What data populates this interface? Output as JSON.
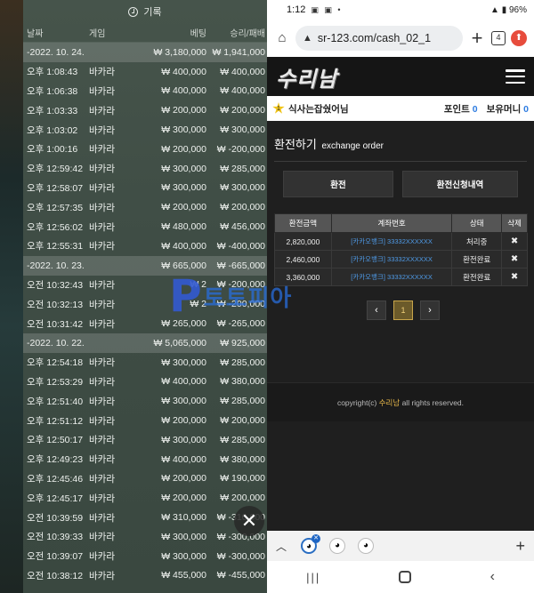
{
  "log": {
    "title": "기록",
    "columns": [
      "날짜",
      "게임",
      "베팅",
      "승리/패배"
    ],
    "rows": [
      {
        "type": "date",
        "date": "-2022. 10. 24.",
        "bet": "₩ 3,180,000",
        "result": "₩ 1,941,000"
      },
      {
        "time": "오후 1:08:43",
        "game": "바카라",
        "bet": "₩ 400,000",
        "result": "₩ 400,000"
      },
      {
        "time": "오후 1:06:38",
        "game": "바카라",
        "bet": "₩ 400,000",
        "result": "₩ 400,000"
      },
      {
        "time": "오후 1:03:33",
        "game": "바카라",
        "bet": "₩ 200,000",
        "result": "₩ 200,000"
      },
      {
        "time": "오후 1:03:02",
        "game": "바카라",
        "bet": "₩ 300,000",
        "result": "₩ 300,000"
      },
      {
        "time": "오후 1:00:16",
        "game": "바카라",
        "bet": "₩ 200,000",
        "result": "₩ -200,000"
      },
      {
        "time": "오후 12:59:42",
        "game": "바카라",
        "bet": "₩ 300,000",
        "result": "₩ 285,000"
      },
      {
        "time": "오후 12:58:07",
        "game": "바카라",
        "bet": "₩ 300,000",
        "result": "₩ 300,000"
      },
      {
        "time": "오후 12:57:35",
        "game": "바카라",
        "bet": "₩ 200,000",
        "result": "₩ 200,000"
      },
      {
        "time": "오후 12:56:02",
        "game": "바카라",
        "bet": "₩ 480,000",
        "result": "₩ 456,000"
      },
      {
        "time": "오후 12:55:31",
        "game": "바카라",
        "bet": "₩ 400,000",
        "result": "₩ -400,000"
      },
      {
        "type": "date",
        "date": "-2022. 10. 23.",
        "bet": "₩ 665,000",
        "result": "₩ -665,000"
      },
      {
        "time": "오전 10:32:43",
        "game": "바카라",
        "bet": "₩ 2",
        "result": "₩ -200,000"
      },
      {
        "time": "오전 10:32:13",
        "game": "바카라",
        "bet": "₩ 2",
        "result": "₩ -200,000"
      },
      {
        "time": "오전 10:31:42",
        "game": "바카라",
        "bet": "₩ 265,000",
        "result": "₩ -265,000"
      },
      {
        "type": "date",
        "date": "-2022. 10. 22.",
        "bet": "₩ 5,065,000",
        "result": "₩ 925,000"
      },
      {
        "time": "오후 12:54:18",
        "game": "바카라",
        "bet": "₩ 300,000",
        "result": "₩ 285,000"
      },
      {
        "time": "오후 12:53:29",
        "game": "바카라",
        "bet": "₩ 400,000",
        "result": "₩ 380,000"
      },
      {
        "time": "오후 12:51:40",
        "game": "바카라",
        "bet": "₩ 300,000",
        "result": "₩ 285,000"
      },
      {
        "time": "오후 12:51:12",
        "game": "바카라",
        "bet": "₩ 200,000",
        "result": "₩ 200,000"
      },
      {
        "time": "오후 12:50:17",
        "game": "바카라",
        "bet": "₩ 300,000",
        "result": "₩ 285,000"
      },
      {
        "time": "오후 12:49:23",
        "game": "바카라",
        "bet": "₩ 400,000",
        "result": "₩ 380,000"
      },
      {
        "time": "오후 12:45:46",
        "game": "바카라",
        "bet": "₩ 200,000",
        "result": "₩ 190,000"
      },
      {
        "time": "오후 12:45:17",
        "game": "바카라",
        "bet": "₩ 200,000",
        "result": "₩ 200,000"
      },
      {
        "time": "오전 10:39:59",
        "game": "바카라",
        "bet": "₩ 310,000",
        "result": "₩ -310,000"
      },
      {
        "time": "오전 10:39:33",
        "game": "바카라",
        "bet": "₩ 300,000",
        "result": "₩ -300,000"
      },
      {
        "time": "오전 10:39:07",
        "game": "바카라",
        "bet": "₩ 300,000",
        "result": "₩ -300,000"
      },
      {
        "time": "오전 10:38:12",
        "game": "바카라",
        "bet": "₩ 455,000",
        "result": "₩ -455,000"
      }
    ],
    "close_icon": "close-icon"
  },
  "status_bar": {
    "time": "1:12",
    "battery": "96%"
  },
  "browser": {
    "url": "sr-123.com/cash_02_1",
    "tab_count": "4"
  },
  "site": {
    "logo": "수리남",
    "user_name": "식사는잡쉈어님",
    "star_level": "1",
    "points_label": "포인트",
    "points_value": "0",
    "money_label": "보유머니",
    "money_value": "0",
    "page_title": "환전하기",
    "page_subtitle": "exchange order",
    "tab_exchange": "환전",
    "tab_history": "환전신청내역",
    "table_headers": [
      "환전금액",
      "계좌번호",
      "상태",
      "삭제"
    ],
    "table_rows": [
      {
        "amount": "2,820,000",
        "account": "[카카오뱅크] 33332XXXXXX",
        "status": "처리중",
        "del": "✖"
      },
      {
        "amount": "2,460,000",
        "account": "[카카오뱅크] 33332XXXXXX",
        "status": "환전완료",
        "del": "✖"
      },
      {
        "amount": "3,360,000",
        "account": "[카카오뱅크] 33332XXXXXX",
        "status": "환전완료",
        "del": "✖"
      }
    ],
    "pager_prev": "‹",
    "pager_current": "1",
    "pager_next": "›",
    "footer_prefix": "copyright(c)",
    "footer_brand": "수리남",
    "footer_suffix": "all rights reserved."
  },
  "watermark": {
    "letter": "P",
    "text": "토토피아"
  },
  "colors": {
    "accent_blue": "#2f7de1",
    "gold": "#e8b84a"
  }
}
